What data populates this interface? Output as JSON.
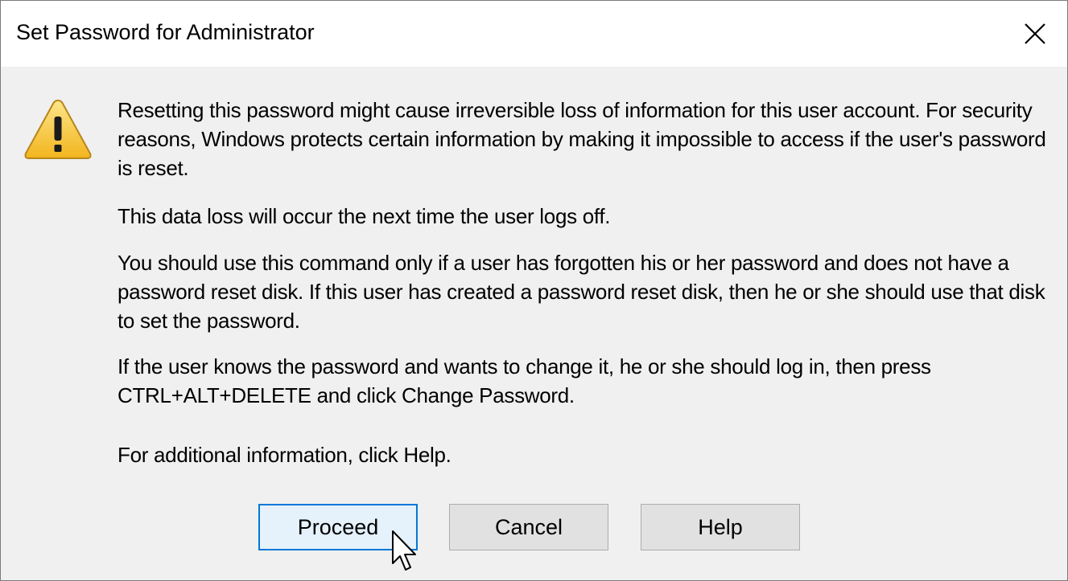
{
  "window": {
    "title": "Set Password for Administrator",
    "close_icon": "close-icon"
  },
  "message": {
    "icon": "warning-icon",
    "paragraphs": [
      "Resetting this password might cause irreversible loss of information for this user account. For security reasons, Windows protects certain information by making it impossible to access if the user's password is reset.",
      "This data loss will occur the next time the user logs off.",
      "You should use this command only if a user has forgotten his or her password and does not have a password reset disk. If this user has created a password reset disk, then he or she should use that disk to set the password.",
      "If the user knows the password and wants to change it, he or she should log in, then press CTRL+ALT+DELETE and click Change Password.",
      "For additional information, click Help."
    ]
  },
  "buttons": {
    "proceed": "Proceed",
    "cancel": "Cancel",
    "help": "Help"
  },
  "colors": {
    "accent": "#0078d7",
    "warning_fill": "#f7c948",
    "dialog_bg": "#f0f0f0"
  }
}
